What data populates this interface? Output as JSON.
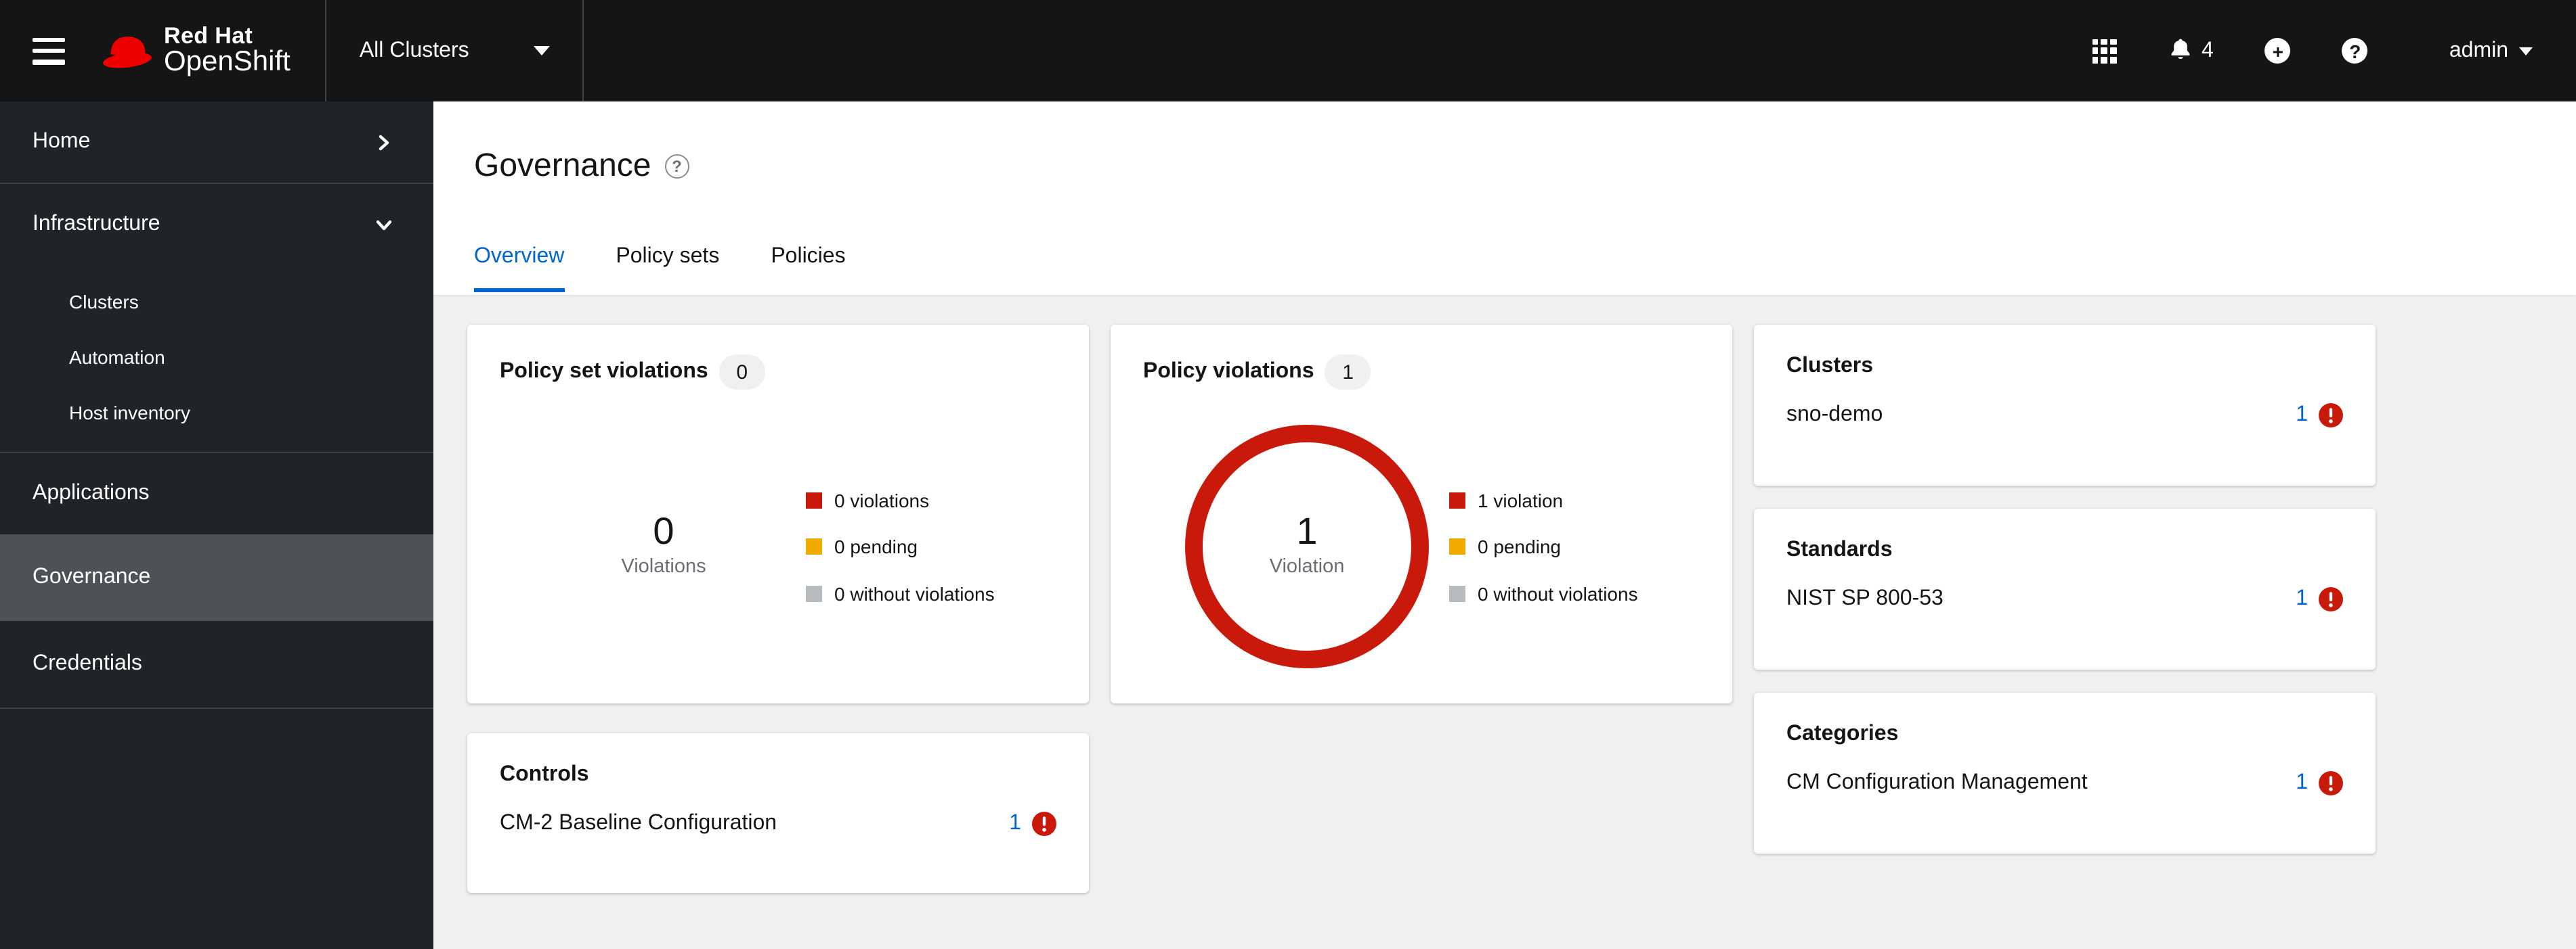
{
  "masthead": {
    "brand_line1": "Red Hat",
    "brand_line2": "OpenShift",
    "cluster_selector_label": "All Clusters",
    "notifications_count": "4",
    "user_label": "admin"
  },
  "sidebar": {
    "home": "Home",
    "infrastructure": "Infrastructure",
    "clusters": "Clusters",
    "automation": "Automation",
    "host_inventory": "Host inventory",
    "applications": "Applications",
    "governance": "Governance",
    "credentials": "Credentials"
  },
  "page": {
    "title": "Governance",
    "help_glyph": "?",
    "tabs": {
      "overview": "Overview",
      "policy_sets": "Policy sets",
      "policies": "Policies"
    }
  },
  "cards": {
    "policy_set_violations": {
      "title": "Policy set violations",
      "badge": "0",
      "value": "0",
      "value_label": "Violations",
      "legend": [
        {
          "label": "0 violations"
        },
        {
          "label": "0 pending"
        },
        {
          "label": "0 without violations"
        }
      ]
    },
    "policy_violations": {
      "title": "Policy violations",
      "badge": "1",
      "value": "1",
      "value_label": "Violation",
      "legend": [
        {
          "label": "1 violation"
        },
        {
          "label": "0 pending"
        },
        {
          "label": "0 without violations"
        }
      ]
    },
    "clusters": {
      "title": "Clusters",
      "row": {
        "name": "sno-demo",
        "count": "1"
      }
    },
    "standards": {
      "title": "Standards",
      "row": {
        "name": "NIST SP 800-53",
        "count": "1"
      }
    },
    "categories": {
      "title": "Categories",
      "row": {
        "name": "CM Configuration Management",
        "count": "1"
      }
    },
    "controls": {
      "title": "Controls",
      "row": {
        "name": "CM-2 Baseline Configuration",
        "count": "1"
      }
    }
  },
  "colors": {
    "danger": "#c9190b",
    "warning": "#f0ab00",
    "neutral": "#b8bbbe",
    "link": "#0066cc",
    "masthead_bg": "#151515",
    "sidebar_bg": "#212427",
    "sidebar_current_bg": "#4f5255",
    "content_bg": "#f0f0f0"
  },
  "chart_data": [
    {
      "type": "donut",
      "title": "Policy set violations",
      "center": {
        "value": 0,
        "label": "Violations"
      },
      "segments": [
        {
          "label": "violations",
          "value": 0,
          "color": "#c9190b"
        },
        {
          "label": "pending",
          "value": 0,
          "color": "#f0ab00"
        },
        {
          "label": "without violations",
          "value": 0,
          "color": "#b8bbbe"
        }
      ]
    },
    {
      "type": "donut",
      "title": "Policy violations",
      "center": {
        "value": 1,
        "label": "Violation"
      },
      "segments": [
        {
          "label": "violation",
          "value": 1,
          "color": "#c9190b"
        },
        {
          "label": "pending",
          "value": 0,
          "color": "#f0ab00"
        },
        {
          "label": "without violations",
          "value": 0,
          "color": "#b8bbbe"
        }
      ]
    }
  ]
}
